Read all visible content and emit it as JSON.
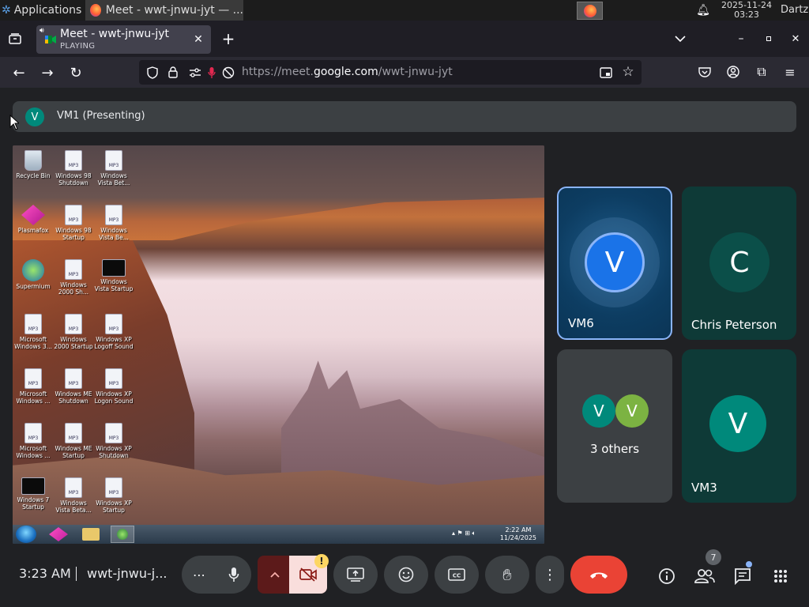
{
  "system": {
    "applications_label": "Applications",
    "active_window_title": "Meet - wwt-jnwu-jyt — ...",
    "clock_date": "2025-11-24",
    "clock_time": "03:23",
    "user": "Dartz"
  },
  "browser": {
    "tab_title": "Meet - wwt-jnwu-jyt",
    "tab_status": "PLAYING",
    "url_prefix": "https://meet.",
    "url_domain": "google.com",
    "url_path": "/wwt-jnwu-jyt"
  },
  "meet": {
    "presenter_initial": "V",
    "presenter_label": "VM1 (Presenting)",
    "time": "3:23 AM",
    "meeting_code": "wwt-jnwu-j...",
    "people_count": "7",
    "tiles": [
      {
        "name": "VM6",
        "initial": "V",
        "color": "#1a73e8"
      },
      {
        "name": "Chris Peterson",
        "initial": "C",
        "color": "#0b4f49"
      },
      {
        "name": "3 others",
        "initials": [
          "V",
          "V"
        ],
        "colors": [
          "#00897b",
          "#7cb342"
        ]
      },
      {
        "name": "VM3",
        "initial": "V",
        "color": "#00897b"
      }
    ]
  },
  "shared_screen": {
    "icons": [
      {
        "label": "Recycle Bin"
      },
      {
        "label": "Windows 98 Shutdown"
      },
      {
        "label": "Windows Vista Bet..."
      },
      {
        "label": "Plasmafox"
      },
      {
        "label": "Windows 98 Startup"
      },
      {
        "label": "Windows Vista Be..."
      },
      {
        "label": "Supermium"
      },
      {
        "label": "Windows 2000 Sh..."
      },
      {
        "label": "Windows Vista Startup"
      },
      {
        "label": "Microsoft Windows 3..."
      },
      {
        "label": "Windows 2000 Startup"
      },
      {
        "label": "Windows XP Logoff Sound"
      },
      {
        "label": "Microsoft Windows ..."
      },
      {
        "label": "Windows ME Shutdown"
      },
      {
        "label": "Windows XP Logon Sound"
      },
      {
        "label": "Microsoft Windows ..."
      },
      {
        "label": "Windows ME Startup"
      },
      {
        "label": "Windows XP Shutdown"
      },
      {
        "label": "Windows 7 Startup"
      },
      {
        "label": "Windows Vista Beta..."
      },
      {
        "label": "Windows XP Startup"
      }
    ],
    "mp3_tag": "MP3",
    "taskbar_time": "2:22 AM",
    "taskbar_date": "11/24/2025"
  }
}
